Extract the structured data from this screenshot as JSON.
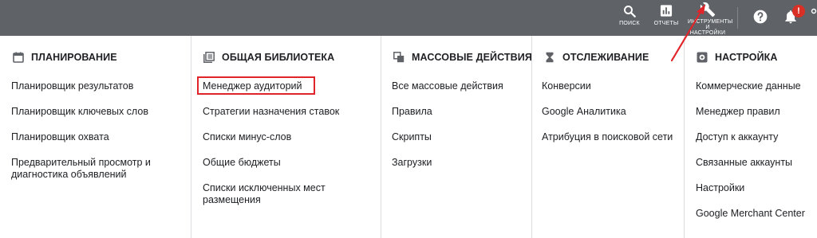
{
  "topbar": {
    "search_label": "ПОИСК",
    "reports_label": "ОТЧЕТЫ",
    "tools_label_line1": "ИНСТРУМЕНТЫ",
    "tools_label_line2": "И НАСТРОЙКИ",
    "notifications_badge": "!",
    "icons": [
      "search-icon",
      "reports-icon",
      "wrench-icon",
      "help-icon",
      "bell-icon",
      "more-icon"
    ]
  },
  "columns": [
    {
      "heading": "ПЛАНИРОВАНИЕ",
      "icon": "calendar-icon",
      "items": [
        "Планировщик результатов",
        "Планировщик ключевых слов",
        "Планировщик охвата",
        "Предварительный просмотр и",
        "диагностика объявлений"
      ]
    },
    {
      "heading": "ОБЩАЯ БИБЛИОТЕКА",
      "icon": "library-icon",
      "items": [
        "Менеджер аудиторий",
        "Стратегии назначения ставок",
        "Списки минус-слов",
        "Общие бюджеты",
        "Списки исключенных мест",
        "размещения"
      ]
    },
    {
      "heading": "МАССОВЫЕ ДЕЙСТВИЯ",
      "icon": "copy-icon",
      "items": [
        "Все массовые действия",
        "Правила",
        "Скрипты",
        "Загрузки"
      ]
    },
    {
      "heading": "ОТСЛЕЖИВАНИЕ",
      "icon": "hourglass-icon",
      "items": [
        "Конверсии",
        "Google Аналитика",
        "Атрибуция в поисковой сети"
      ]
    },
    {
      "heading": "НАСТРОЙКА",
      "icon": "settings-box-icon",
      "items": [
        "Коммерческие данные",
        "Менеджер правил",
        "Доступ к аккаунту",
        "Связанные аккаунты",
        "Настройки",
        "Google Merchant Center"
      ]
    }
  ],
  "annotation": {
    "highlight_color": "#e0242a",
    "arrow_color": "#e0242a"
  },
  "colors": {
    "topbar": "#5f6368",
    "divider": "#dadce0"
  }
}
